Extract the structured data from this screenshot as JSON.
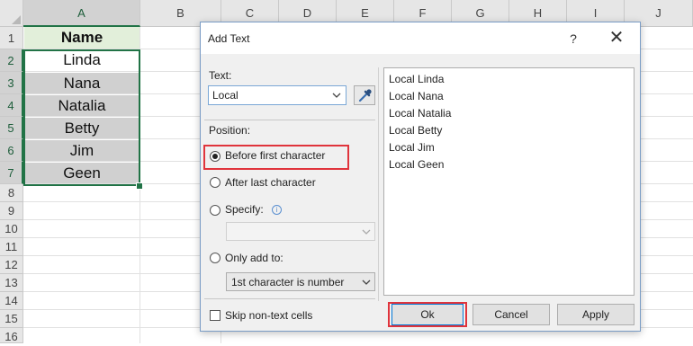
{
  "spreadsheet": {
    "columns": [
      "A",
      "B",
      "C",
      "D",
      "E",
      "F",
      "G",
      "H",
      "I",
      "J"
    ],
    "rows": [
      "1",
      "2",
      "3",
      "4",
      "5",
      "6",
      "7",
      "8",
      "9",
      "10",
      "11",
      "12",
      "13",
      "14",
      "15",
      "16"
    ],
    "cells": [
      "Name",
      "Linda",
      "Nana",
      "Natalia",
      "Betty",
      "Jim",
      "Geen"
    ]
  },
  "dialog": {
    "title": "Add Text",
    "help": "?",
    "close": "✕",
    "text_label": "Text:",
    "text_value": "Local",
    "position_label": "Position:",
    "options": {
      "before_first": "Before first character",
      "after_last": "After last character",
      "specify": "Specify:",
      "only_add_to": "Only add to:"
    },
    "only_add_to_value": "1st character is number",
    "skip_non_text": "Skip non-text cells",
    "preview": [
      "Local Linda",
      "Local Nana",
      "Local Natalia",
      "Local Betty",
      "Local Jim",
      "Local Geen"
    ],
    "buttons": {
      "ok": "Ok",
      "cancel": "Cancel",
      "apply": "Apply"
    }
  },
  "colors": {
    "highlight": "#e0343c",
    "selection": "#217346",
    "header_fill": "#e2efda"
  }
}
